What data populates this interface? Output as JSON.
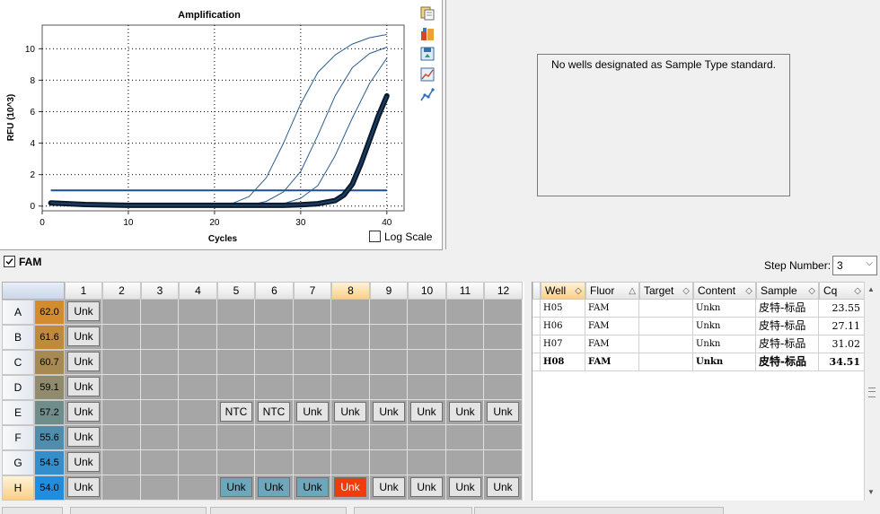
{
  "chart": {
    "title": "Amplification",
    "ylabel": "RFU (10^3)",
    "xlabel": "Cycles",
    "log_scale_label": "Log Scale",
    "log_scale_checked": false,
    "threshold_color": "#1f4e8c",
    "line_color": "#2a5d8f",
    "highlight_line_color": "#0a1a2a"
  },
  "chart_data": {
    "type": "line",
    "title": "Amplification",
    "xlabel": "Cycles",
    "ylabel": "RFU (10^3)",
    "xlim": [
      0,
      42
    ],
    "ylim": [
      -0.3,
      11.5
    ],
    "x_ticks": [
      "0",
      "10",
      "20",
      "30",
      "40"
    ],
    "y_ticks": [
      "0",
      "2",
      "4",
      "6",
      "8",
      "10"
    ],
    "threshold": 1.0,
    "grid": true,
    "series": [
      {
        "x": [
          1,
          5,
          10,
          15,
          20,
          22,
          24,
          26,
          28,
          30,
          32,
          34,
          36,
          38,
          40
        ],
        "y": [
          0.1,
          0.05,
          0.0,
          0.0,
          0.0,
          0.15,
          0.6,
          1.8,
          4.0,
          6.5,
          8.5,
          9.6,
          10.3,
          10.7,
          10.9
        ]
      },
      {
        "x": [
          1,
          5,
          10,
          15,
          20,
          22,
          24,
          26,
          28,
          30,
          32,
          34,
          36,
          38,
          40
        ],
        "y": [
          0.1,
          0.05,
          0.0,
          0.0,
          0.0,
          0.0,
          0.05,
          0.3,
          0.9,
          2.2,
          4.5,
          7.0,
          8.8,
          9.7,
          10.1
        ]
      },
      {
        "x": [
          1,
          5,
          10,
          15,
          20,
          22,
          24,
          26,
          28,
          30,
          32,
          34,
          36,
          38,
          40
        ],
        "y": [
          0.1,
          0.05,
          0.0,
          0.0,
          0.0,
          0.0,
          0.0,
          0.05,
          0.15,
          0.5,
          1.3,
          3.2,
          5.6,
          7.8,
          9.4
        ]
      },
      {
        "x": [
          1,
          5,
          10,
          15,
          20,
          22,
          24,
          26,
          28,
          30,
          32,
          34,
          35,
          36,
          37,
          38,
          39,
          40
        ],
        "y": [
          0.2,
          0.1,
          0.05,
          0.05,
          0.05,
          0.05,
          0.05,
          0.05,
          0.05,
          0.08,
          0.15,
          0.35,
          0.7,
          1.4,
          2.7,
          4.2,
          5.7,
          7.0
        ]
      }
    ]
  },
  "toolbar_icons": [
    "copy-icon",
    "export-icon",
    "save-chart-icon",
    "zoom-chart-icon",
    "line-chart-icon"
  ],
  "standard_panel": {
    "message": "No wells designated as Sample Type standard."
  },
  "fluor_bar": {
    "fluor_label": "FAM",
    "fluor_checked": true,
    "step_label": "Step Number:",
    "step_value": "3"
  },
  "plate": {
    "columns": [
      "1",
      "2",
      "3",
      "4",
      "5",
      "6",
      "7",
      "8",
      "9",
      "10",
      "11",
      "12"
    ],
    "selected_column": "8",
    "rows": [
      {
        "letter": "A",
        "temp": "62.0",
        "color": "#d48a2e",
        "wells": [
          "Unk",
          "",
          "",
          "",
          "",
          "",
          "",
          "",
          "",
          "",
          "",
          ""
        ]
      },
      {
        "letter": "B",
        "temp": "61.6",
        "color": "#bf8b3a",
        "wells": [
          "Unk",
          "",
          "",
          "",
          "",
          "",
          "",
          "",
          "",
          "",
          "",
          ""
        ]
      },
      {
        "letter": "C",
        "temp": "60.7",
        "color": "#a78a52",
        "wells": [
          "Unk",
          "",
          "",
          "",
          "",
          "",
          "",
          "",
          "",
          "",
          "",
          ""
        ]
      },
      {
        "letter": "D",
        "temp": "59.1",
        "color": "#8f8b6c",
        "wells": [
          "Unk",
          "",
          "",
          "",
          "",
          "",
          "",
          "",
          "",
          "",
          "",
          ""
        ]
      },
      {
        "letter": "E",
        "temp": "57.2",
        "color": "#6f8d8a",
        "wells": [
          "Unk",
          "",
          "",
          "",
          "NTC",
          "NTC",
          "Unk",
          "Unk",
          "Unk",
          "Unk",
          "Unk",
          "Unk"
        ]
      },
      {
        "letter": "F",
        "temp": "55.6",
        "color": "#4e8dad",
        "wells": [
          "Unk",
          "",
          "",
          "",
          "",
          "",
          "",
          "",
          "",
          "",
          "",
          ""
        ]
      },
      {
        "letter": "G",
        "temp": "54.5",
        "color": "#338ecb",
        "wells": [
          "Unk",
          "",
          "",
          "",
          "",
          "",
          "",
          "",
          "",
          "",
          "",
          ""
        ]
      },
      {
        "letter": "H",
        "temp": "54.0",
        "color": "#1f8ee0",
        "selected": true,
        "wells": [
          "Unk",
          "",
          "",
          "",
          "Unk",
          "Unk",
          "Unk",
          "Unk",
          "Unk",
          "Unk",
          "Unk",
          "Unk"
        ]
      }
    ]
  },
  "results": {
    "headers": [
      "Well",
      "Fluor",
      "Target",
      "Content",
      "Sample",
      "Cq"
    ],
    "rows": [
      {
        "well": "H05",
        "fluor": "FAM",
        "target": "",
        "content": "Unkn",
        "sample": "皮特-标品",
        "cq": "23.55"
      },
      {
        "well": "H06",
        "fluor": "FAM",
        "target": "",
        "content": "Unkn",
        "sample": "皮特-标品",
        "cq": "27.11"
      },
      {
        "well": "H07",
        "fluor": "FAM",
        "target": "",
        "content": "Unkn",
        "sample": "皮特-标品",
        "cq": "31.02"
      },
      {
        "well": "H08",
        "fluor": "FAM",
        "target": "",
        "content": "Unkn",
        "sample": "皮特-标品",
        "cq": "34.51",
        "bold": true
      }
    ]
  }
}
